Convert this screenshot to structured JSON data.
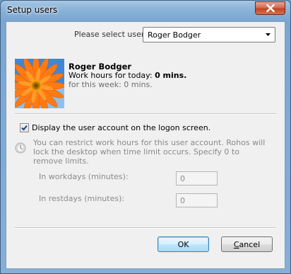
{
  "window": {
    "title": "Setup users"
  },
  "user_select": {
    "label": "Please select user:",
    "value": "Roger Bodger"
  },
  "user": {
    "name": "Roger Bodger",
    "hours_today_label": "Work hours for today:",
    "hours_today_value": "0 mins.",
    "hours_week": "for this week: 0 mins."
  },
  "logon": {
    "checked": true,
    "label": "Display the user account on the logon screen."
  },
  "info_text": "You can restrict work hours for this user account. Rohos will lock the desktop when time limit occurs. Specify 0 to remove limits.",
  "limits": {
    "workdays_label": "In workdays (minutes):",
    "workdays_value": "0",
    "restdays_label": "In restdays (minutes):",
    "restdays_value": "0"
  },
  "buttons": {
    "ok": "OK",
    "cancel_first": "C",
    "cancel_rest": "ancel"
  },
  "icons": {
    "close": "close-icon",
    "dropdown": "chevron-down-icon",
    "clock": "clock-icon",
    "avatar": "flower-avatar",
    "check": "checkmark-icon"
  }
}
